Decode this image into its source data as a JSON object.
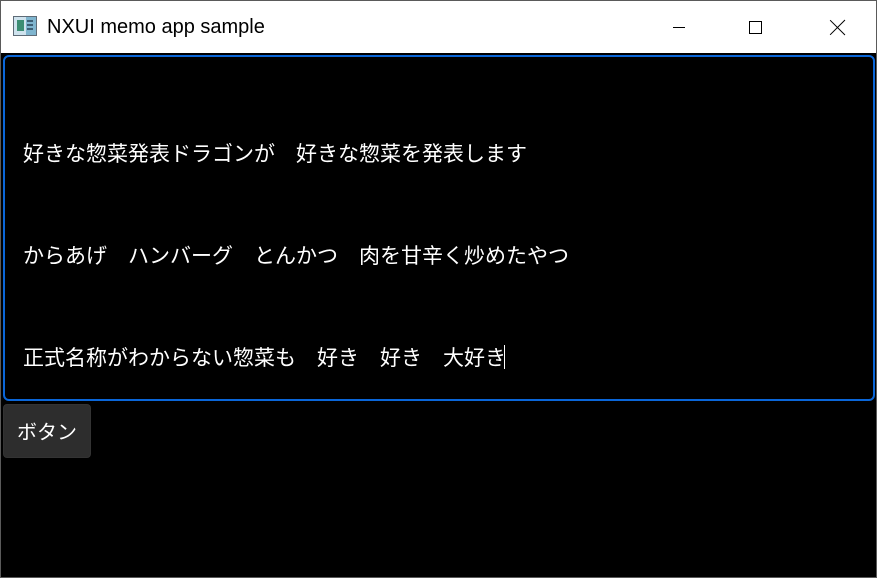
{
  "window": {
    "title": "NXUI memo app sample",
    "icon": "app-window-icon",
    "controls": {
      "minimize_icon": "minimize-icon",
      "maximize_icon": "maximize-icon",
      "close_icon": "close-icon"
    }
  },
  "memo": {
    "lines": [
      "好きな惣菜発表ドラゴンが　好きな惣菜を発表します",
      "からあげ　ハンバーグ　とんかつ　肉を甘辛く炒めたやつ",
      "正式名称がわからない惣菜も　好き　好き　大好き"
    ],
    "border_color": "#0a66d8",
    "text_color": "#ffffff",
    "background_color": "#000000"
  },
  "button": {
    "label": "ボタン",
    "background_color": "#2d2d2d",
    "text_color": "#ffffff"
  },
  "theme": {
    "titlebar_background": "#ffffff",
    "window_background": "#000000"
  }
}
